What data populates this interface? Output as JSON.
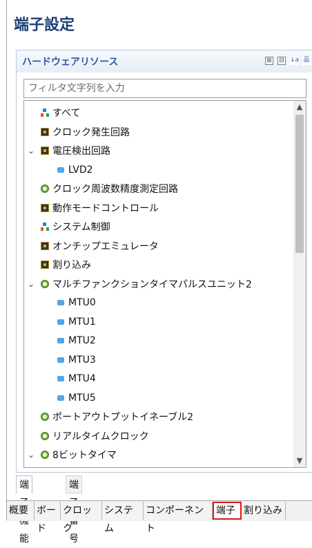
{
  "page": {
    "title": "端子設定"
  },
  "panel": {
    "title": "ハードウェアリソース",
    "toolbar": [
      {
        "icon": "expand-all-icon",
        "glyph": "⊞"
      },
      {
        "icon": "collapse-all-icon",
        "glyph": "⊟"
      },
      {
        "icon": "sort-az-icon",
        "glyph": "↓a"
      },
      {
        "icon": "hierarchy-icon",
        "glyph": "品"
      }
    ]
  },
  "filter": {
    "placeholder": "フィルタ文字列を入力",
    "value": ""
  },
  "tree": {
    "items": [
      {
        "label": "すべて",
        "icon": "tree-net-icon",
        "level": 0,
        "expander": ""
      },
      {
        "label": "クロック発生回路",
        "icon": "chip-icon",
        "level": 0,
        "expander": ""
      },
      {
        "label": "電圧検出回路",
        "icon": "chip-icon",
        "level": 0,
        "expander": "expanded"
      },
      {
        "label": "LVD2",
        "icon": "dot-icon",
        "level": 1,
        "expander": ""
      },
      {
        "label": "クロック周波数精度測定回路",
        "icon": "clock-icon",
        "level": 0,
        "expander": ""
      },
      {
        "label": "動作モードコントロール",
        "icon": "chip-icon",
        "level": 0,
        "expander": ""
      },
      {
        "label": "システム制御",
        "icon": "tree-net-icon",
        "level": 0,
        "expander": ""
      },
      {
        "label": "オンチップエミュレータ",
        "icon": "chip-icon",
        "level": 0,
        "expander": ""
      },
      {
        "label": "割り込み",
        "icon": "chip-icon",
        "level": 0,
        "expander": ""
      },
      {
        "label": "マルチファンクションタイマパルスユニット2",
        "icon": "clock-icon",
        "level": 0,
        "expander": "expanded"
      },
      {
        "label": "MTU0",
        "icon": "dot-icon",
        "level": 1,
        "expander": ""
      },
      {
        "label": "MTU1",
        "icon": "dot-icon",
        "level": 1,
        "expander": ""
      },
      {
        "label": "MTU2",
        "icon": "dot-icon",
        "level": 1,
        "expander": ""
      },
      {
        "label": "MTU3",
        "icon": "dot-icon",
        "level": 1,
        "expander": ""
      },
      {
        "label": "MTU4",
        "icon": "dot-icon",
        "level": 1,
        "expander": ""
      },
      {
        "label": "MTU5",
        "icon": "dot-icon",
        "level": 1,
        "expander": ""
      },
      {
        "label": "ポートアウトプットイネーブル2",
        "icon": "clock-icon",
        "level": 0,
        "expander": ""
      },
      {
        "label": "リアルタイムクロック",
        "icon": "clock-icon",
        "level": 0,
        "expander": ""
      },
      {
        "label": "8ビットタイマ",
        "icon": "clock-icon",
        "level": 0,
        "expander": "expanded"
      }
    ]
  },
  "sub_tabs": [
    {
      "label": "端子機能",
      "active": true
    },
    {
      "label": "端子番号",
      "active": false
    }
  ],
  "bottom_tabs": [
    {
      "label": "概要",
      "selected": false
    },
    {
      "label": "ボード",
      "selected": false
    },
    {
      "label": "クロック",
      "selected": false
    },
    {
      "label": "システム",
      "selected": false
    },
    {
      "label": "コンポーネント",
      "selected": false
    },
    {
      "label": "端子",
      "selected": true
    },
    {
      "label": "割り込み",
      "selected": false
    }
  ],
  "colors": {
    "title": "#1f3f77",
    "panel_title": "#2b56a3",
    "selected_tab_border": "#e11818"
  }
}
